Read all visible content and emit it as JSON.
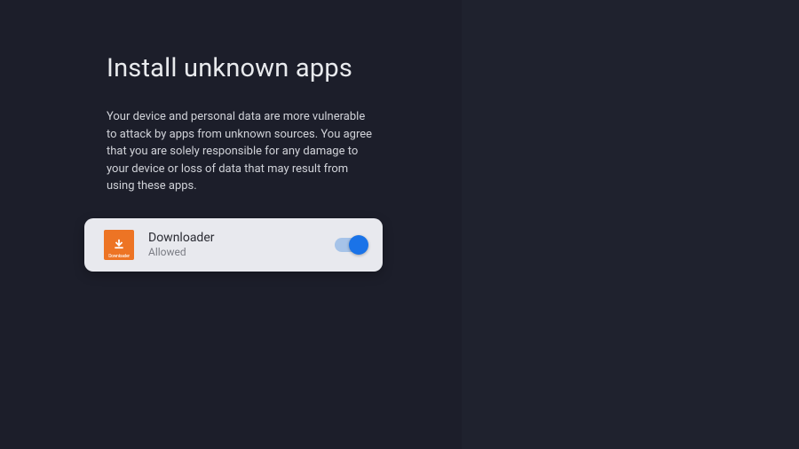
{
  "page": {
    "title": "Install unknown apps",
    "description": "Your device and personal data are more vulnerable to attack by apps from unknown sources. You agree that you are solely responsible for any damage to your device or loss of data that may result from using these apps."
  },
  "app": {
    "name": "Downloader",
    "status": "Allowed",
    "icon_label": "Downloader",
    "toggle_on": true
  },
  "colors": {
    "background": "#1c1e2a",
    "card": "#e8e9ee",
    "accent": "#1a73e8",
    "icon_bg": "#ed7424"
  }
}
